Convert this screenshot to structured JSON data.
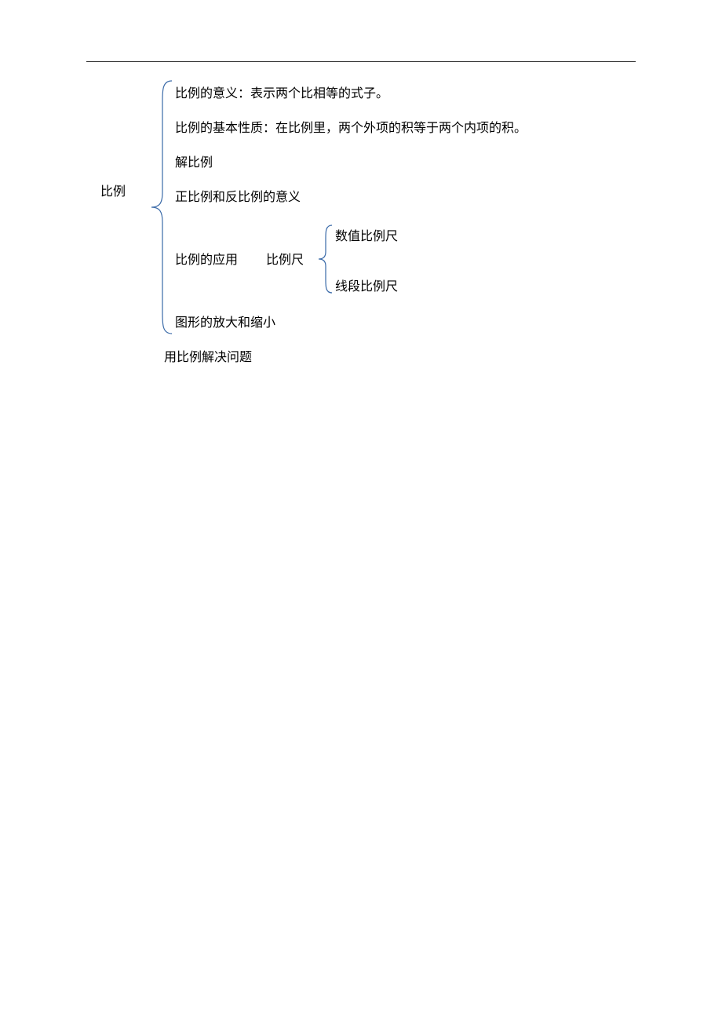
{
  "root": "比例",
  "items": {
    "meaning": "比例的意义：表示两个比相等的式子。",
    "property": "比例的基本性质：在比例里，两个外项的积等于两个内项的积。",
    "solve": "解比例",
    "direct_inverse": "正比例和反比例的意义",
    "application": "比例的应用",
    "scale": "比例尺",
    "scale_numeric": "数值比例尺",
    "scale_segment": "线段比例尺",
    "enlarge_shrink": "图形的放大和缩小",
    "solve_problems": "用比例解决问题"
  }
}
